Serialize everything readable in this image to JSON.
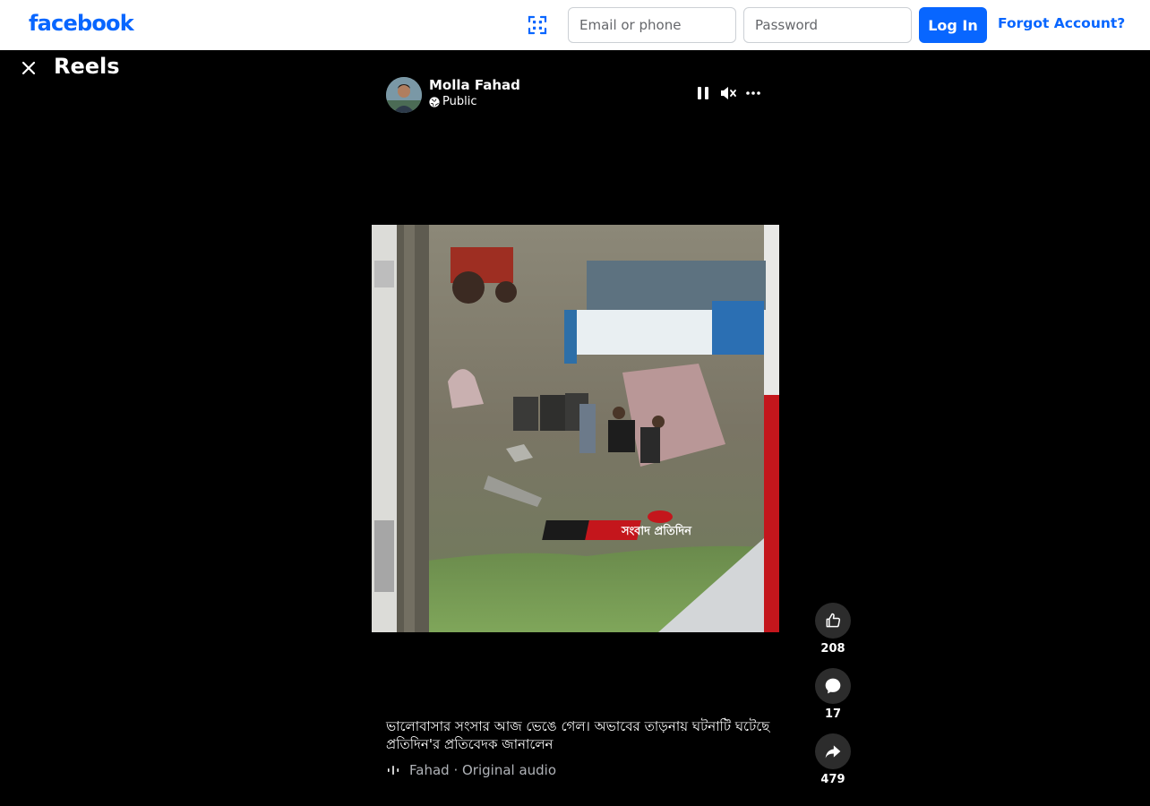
{
  "header": {
    "logo": "facebook",
    "email_placeholder": "Email or phone",
    "password_placeholder": "Password",
    "login_label": "Log In",
    "forgot_label": "Forgot Account?",
    "brand_color": "#0866ff"
  },
  "reels": {
    "title": "Reels"
  },
  "post": {
    "author": "Molla Fahad",
    "privacy": "Public",
    "caption": "ভালোবাসার সংসার আজ ভেঙে গেল। অভাবের তাড়নায় ঘটনাটি ঘটেছে প্রতিদিন'র প্রতিবেদক জানালেন",
    "audio_name": "Fahad",
    "audio_sep": " · ",
    "audio_label": "Original audio",
    "watermark": "সংবাদ প্রতিদিন"
  },
  "actions": {
    "likes": "208",
    "comments": "17",
    "shares": "479"
  },
  "icons": {
    "qr": "qr-scan-icon",
    "close": "close-icon",
    "pause": "pause-icon",
    "mute": "mute-icon",
    "more": "more-icon",
    "like": "like-icon",
    "comment": "comment-icon",
    "share": "share-icon",
    "globe": "globe-icon",
    "audio": "audio-wave-icon"
  }
}
